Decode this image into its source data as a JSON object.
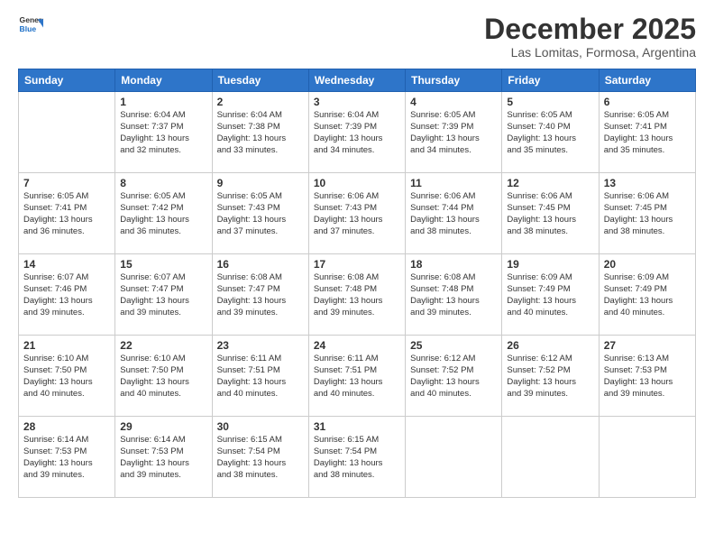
{
  "logo": {
    "line1": "General",
    "line2": "Blue"
  },
  "title": "December 2025",
  "subtitle": "Las Lomitas, Formosa, Argentina",
  "weekdays": [
    "Sunday",
    "Monday",
    "Tuesday",
    "Wednesday",
    "Thursday",
    "Friday",
    "Saturday"
  ],
  "weeks": [
    [
      {
        "day": "",
        "text": ""
      },
      {
        "day": "1",
        "text": "Sunrise: 6:04 AM\nSunset: 7:37 PM\nDaylight: 13 hours\nand 32 minutes."
      },
      {
        "day": "2",
        "text": "Sunrise: 6:04 AM\nSunset: 7:38 PM\nDaylight: 13 hours\nand 33 minutes."
      },
      {
        "day": "3",
        "text": "Sunrise: 6:04 AM\nSunset: 7:39 PM\nDaylight: 13 hours\nand 34 minutes."
      },
      {
        "day": "4",
        "text": "Sunrise: 6:05 AM\nSunset: 7:39 PM\nDaylight: 13 hours\nand 34 minutes."
      },
      {
        "day": "5",
        "text": "Sunrise: 6:05 AM\nSunset: 7:40 PM\nDaylight: 13 hours\nand 35 minutes."
      },
      {
        "day": "6",
        "text": "Sunrise: 6:05 AM\nSunset: 7:41 PM\nDaylight: 13 hours\nand 35 minutes."
      }
    ],
    [
      {
        "day": "7",
        "text": "Sunrise: 6:05 AM\nSunset: 7:41 PM\nDaylight: 13 hours\nand 36 minutes."
      },
      {
        "day": "8",
        "text": "Sunrise: 6:05 AM\nSunset: 7:42 PM\nDaylight: 13 hours\nand 36 minutes."
      },
      {
        "day": "9",
        "text": "Sunrise: 6:05 AM\nSunset: 7:43 PM\nDaylight: 13 hours\nand 37 minutes."
      },
      {
        "day": "10",
        "text": "Sunrise: 6:06 AM\nSunset: 7:43 PM\nDaylight: 13 hours\nand 37 minutes."
      },
      {
        "day": "11",
        "text": "Sunrise: 6:06 AM\nSunset: 7:44 PM\nDaylight: 13 hours\nand 38 minutes."
      },
      {
        "day": "12",
        "text": "Sunrise: 6:06 AM\nSunset: 7:45 PM\nDaylight: 13 hours\nand 38 minutes."
      },
      {
        "day": "13",
        "text": "Sunrise: 6:06 AM\nSunset: 7:45 PM\nDaylight: 13 hours\nand 38 minutes."
      }
    ],
    [
      {
        "day": "14",
        "text": "Sunrise: 6:07 AM\nSunset: 7:46 PM\nDaylight: 13 hours\nand 39 minutes."
      },
      {
        "day": "15",
        "text": "Sunrise: 6:07 AM\nSunset: 7:47 PM\nDaylight: 13 hours\nand 39 minutes."
      },
      {
        "day": "16",
        "text": "Sunrise: 6:08 AM\nSunset: 7:47 PM\nDaylight: 13 hours\nand 39 minutes."
      },
      {
        "day": "17",
        "text": "Sunrise: 6:08 AM\nSunset: 7:48 PM\nDaylight: 13 hours\nand 39 minutes."
      },
      {
        "day": "18",
        "text": "Sunrise: 6:08 AM\nSunset: 7:48 PM\nDaylight: 13 hours\nand 39 minutes."
      },
      {
        "day": "19",
        "text": "Sunrise: 6:09 AM\nSunset: 7:49 PM\nDaylight: 13 hours\nand 40 minutes."
      },
      {
        "day": "20",
        "text": "Sunrise: 6:09 AM\nSunset: 7:49 PM\nDaylight: 13 hours\nand 40 minutes."
      }
    ],
    [
      {
        "day": "21",
        "text": "Sunrise: 6:10 AM\nSunset: 7:50 PM\nDaylight: 13 hours\nand 40 minutes."
      },
      {
        "day": "22",
        "text": "Sunrise: 6:10 AM\nSunset: 7:50 PM\nDaylight: 13 hours\nand 40 minutes."
      },
      {
        "day": "23",
        "text": "Sunrise: 6:11 AM\nSunset: 7:51 PM\nDaylight: 13 hours\nand 40 minutes."
      },
      {
        "day": "24",
        "text": "Sunrise: 6:11 AM\nSunset: 7:51 PM\nDaylight: 13 hours\nand 40 minutes."
      },
      {
        "day": "25",
        "text": "Sunrise: 6:12 AM\nSunset: 7:52 PM\nDaylight: 13 hours\nand 40 minutes."
      },
      {
        "day": "26",
        "text": "Sunrise: 6:12 AM\nSunset: 7:52 PM\nDaylight: 13 hours\nand 39 minutes."
      },
      {
        "day": "27",
        "text": "Sunrise: 6:13 AM\nSunset: 7:53 PM\nDaylight: 13 hours\nand 39 minutes."
      }
    ],
    [
      {
        "day": "28",
        "text": "Sunrise: 6:14 AM\nSunset: 7:53 PM\nDaylight: 13 hours\nand 39 minutes."
      },
      {
        "day": "29",
        "text": "Sunrise: 6:14 AM\nSunset: 7:53 PM\nDaylight: 13 hours\nand 39 minutes."
      },
      {
        "day": "30",
        "text": "Sunrise: 6:15 AM\nSunset: 7:54 PM\nDaylight: 13 hours\nand 38 minutes."
      },
      {
        "day": "31",
        "text": "Sunrise: 6:15 AM\nSunset: 7:54 PM\nDaylight: 13 hours\nand 38 minutes."
      },
      {
        "day": "",
        "text": ""
      },
      {
        "day": "",
        "text": ""
      },
      {
        "day": "",
        "text": ""
      }
    ]
  ]
}
